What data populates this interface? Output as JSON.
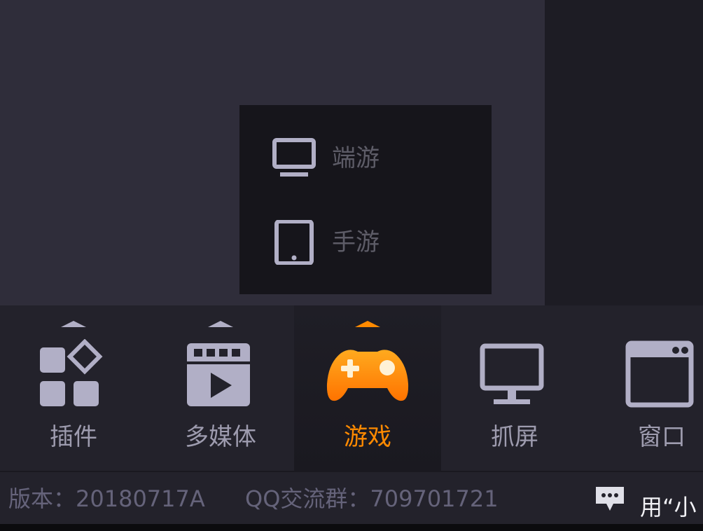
{
  "popup": {
    "items": [
      {
        "label": "端游",
        "icon": "monitor-icon"
      },
      {
        "label": "手游",
        "icon": "tablet-icon"
      }
    ]
  },
  "toolbar": {
    "items": [
      {
        "label": "插件",
        "icon": "plugins-grid-icon",
        "active": false
      },
      {
        "label": "多媒体",
        "icon": "media-clapper-icon",
        "active": false
      },
      {
        "label": "游戏",
        "icon": "gamepad-icon",
        "active": true
      },
      {
        "label": "抓屏",
        "icon": "monitor-icon",
        "active": false
      },
      {
        "label": "窗口",
        "icon": "window-icon",
        "active": false
      }
    ]
  },
  "status": {
    "version": "版本：20180717A",
    "qq_group": "QQ交流群：709701721",
    "feedback": "用“小"
  },
  "colors": {
    "accent": "#ff8a00",
    "icon": "#b1afc6",
    "label": "#9e9caf",
    "status_text": "#65637a"
  }
}
